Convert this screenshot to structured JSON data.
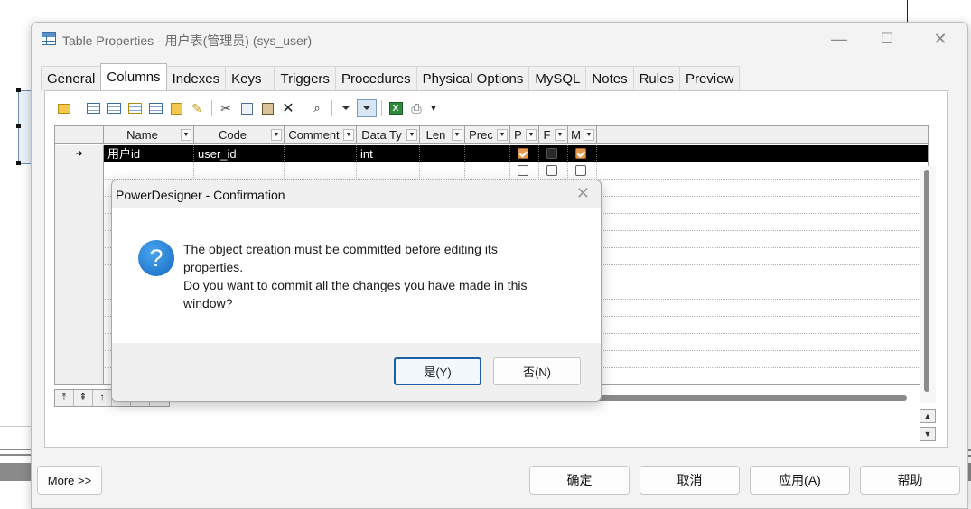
{
  "window": {
    "title": "Table Properties - 用户表(管理员) (sys_user)",
    "minimize_icon": "—",
    "maximize_icon": "☐",
    "close_icon": "✕"
  },
  "tabs": [
    {
      "label": "General",
      "active": false
    },
    {
      "label": "Columns",
      "active": true
    },
    {
      "label": "Indexes",
      "active": false
    },
    {
      "label": "Keys",
      "active": false
    },
    {
      "label": "Triggers",
      "active": false
    },
    {
      "label": "Procedures",
      "active": false
    },
    {
      "label": "Physical Options",
      "active": false
    },
    {
      "label": "MySQL",
      "active": false
    },
    {
      "label": "Notes",
      "active": false
    },
    {
      "label": "Rules",
      "active": false
    },
    {
      "label": "Preview",
      "active": false
    }
  ],
  "grid": {
    "columns": [
      "Name",
      "Code",
      "Comment",
      "Data Ty",
      "Len",
      "Prec",
      "P",
      "F",
      "M"
    ],
    "rows": [
      {
        "marker": "➜",
        "name": "用户id",
        "code": "user_id",
        "comment": "",
        "data_type": "int",
        "length": "",
        "precision": "",
        "primary": true,
        "foreign": false,
        "mandatory": true,
        "selected": true
      }
    ]
  },
  "buttons": {
    "more": "More >>",
    "ok": "确定",
    "cancel": "取消",
    "apply": "应用(A)",
    "help": "帮助"
  },
  "dialog": {
    "title": "PowerDesigner - Confirmation",
    "line1": "The object creation must be committed before editing its",
    "line2": "properties.",
    "line3": "Do you want to commit all the changes you have made in this",
    "line4": "window?",
    "yes": "是(Y)",
    "no": "否(N)",
    "close_icon": "✕",
    "question_glyph": "?"
  }
}
